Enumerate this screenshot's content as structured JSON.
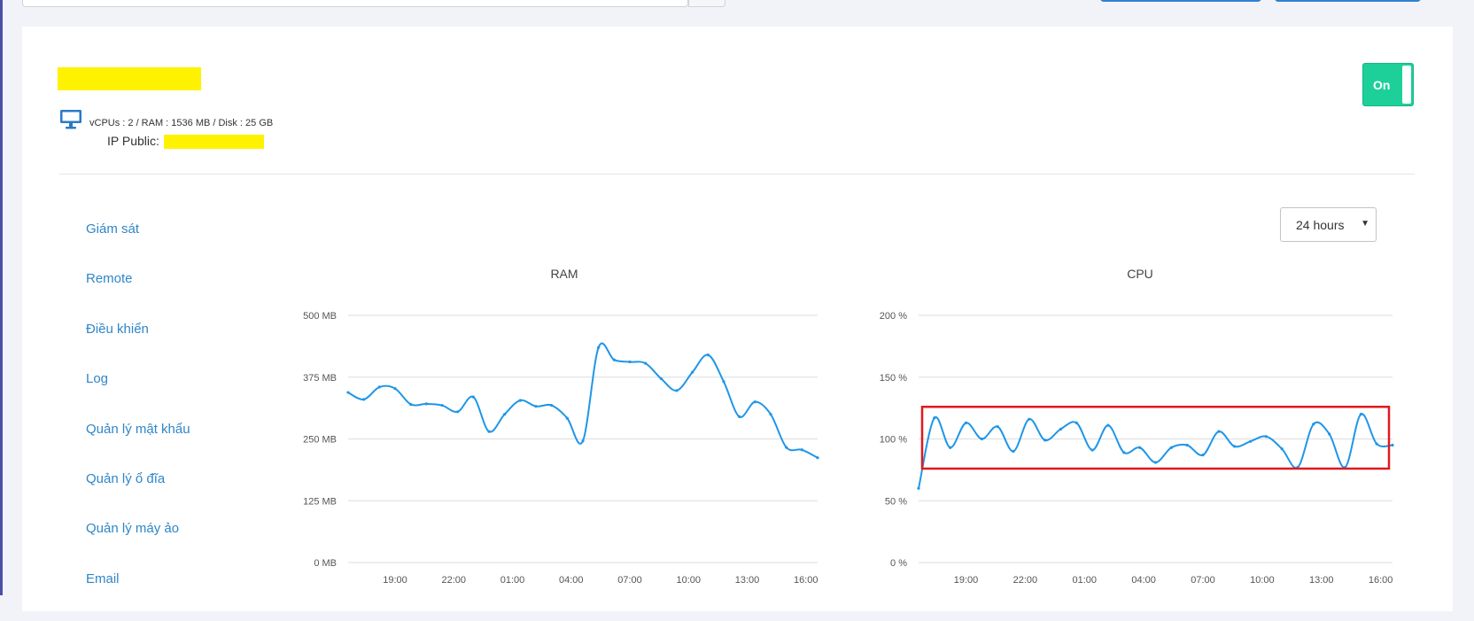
{
  "server": {
    "specs": "vCPUs : 2 / RAM : 1536 MB / Disk : 25 GB",
    "ip_label": "IP Public:"
  },
  "power_toggle": {
    "label": "On",
    "state": "on",
    "color": "#1dd09a"
  },
  "side_menu": [
    {
      "label": "Giám sát"
    },
    {
      "label": "Remote"
    },
    {
      "label": "Điều khiển"
    },
    {
      "label": "Log"
    },
    {
      "label": "Quản lý mật khẩu"
    },
    {
      "label": "Quản lý ổ đĩa"
    },
    {
      "label": "Quản lý máy ảo"
    },
    {
      "label": "Email"
    }
  ],
  "time_range": {
    "selected": "24 hours"
  },
  "colors": {
    "line": "#1f96e8",
    "highlight": "#e0191f",
    "link": "#2f86c8",
    "grid": "#dcdde0"
  },
  "chart_data": [
    {
      "type": "line",
      "title": "RAM",
      "y_ticks": [
        "0 MB",
        "125 MB",
        "250 MB",
        "375 MB",
        "500 MB"
      ],
      "ylim": [
        0,
        500
      ],
      "x_ticks": [
        "19:00",
        "22:00",
        "01:00",
        "04:00",
        "07:00",
        "10:00",
        "13:00",
        "16:00"
      ],
      "x_tick_positions": [
        2.4,
        5.4,
        8.4,
        11.4,
        14.4,
        17.4,
        20.4,
        23.4
      ],
      "xlim": [
        0,
        24
      ],
      "x": [
        0,
        0.8,
        1.6,
        2.4,
        3.2,
        4,
        4.8,
        5.6,
        6.4,
        7.2,
        8,
        8.8,
        9.6,
        10.4,
        11.2,
        12,
        12.8,
        13.6,
        14.4,
        15.2,
        16,
        16.8,
        17.6,
        18.4,
        19.2,
        20,
        20.8,
        21.6,
        22.4,
        23.2,
        24
      ],
      "values": [
        344,
        330,
        355,
        352,
        320,
        321,
        318,
        305,
        335,
        265,
        300,
        328,
        316,
        318,
        292,
        246,
        435,
        410,
        406,
        403,
        372,
        348,
        385,
        420,
        366,
        295,
        325,
        300,
        233,
        228,
        212
      ],
      "series": [
        {
          "name": "RAM"
        }
      ]
    },
    {
      "type": "line",
      "title": "CPU",
      "y_ticks": [
        "0 %",
        "50 %",
        "100 %",
        "150 %",
        "200 %"
      ],
      "ylim": [
        0,
        200
      ],
      "x_ticks": [
        "19:00",
        "22:00",
        "01:00",
        "04:00",
        "07:00",
        "10:00",
        "13:00",
        "16:00"
      ],
      "x_tick_positions": [
        2.4,
        5.4,
        8.4,
        11.4,
        14.4,
        17.4,
        20.4,
        23.4
      ],
      "xlim": [
        0,
        24
      ],
      "x": [
        0,
        0.8,
        1.6,
        2.4,
        3.2,
        4,
        4.8,
        5.6,
        6.4,
        7.2,
        8,
        8.8,
        9.6,
        10.4,
        11.2,
        12,
        12.8,
        13.6,
        14.4,
        15.2,
        16,
        16.8,
        17.6,
        18.4,
        19.2,
        20,
        20.8,
        21.6,
        22.4,
        23.2,
        24
      ],
      "values": [
        60,
        117,
        93,
        113,
        100,
        110,
        90,
        116,
        99,
        108,
        113,
        91,
        111,
        89,
        93,
        81,
        93,
        95,
        87,
        106,
        94,
        98,
        102,
        92,
        77,
        112,
        104,
        77,
        120,
        96,
        95
      ],
      "highlight_range": [
        76,
        126
      ],
      "series": [
        {
          "name": "CPU"
        }
      ]
    }
  ]
}
